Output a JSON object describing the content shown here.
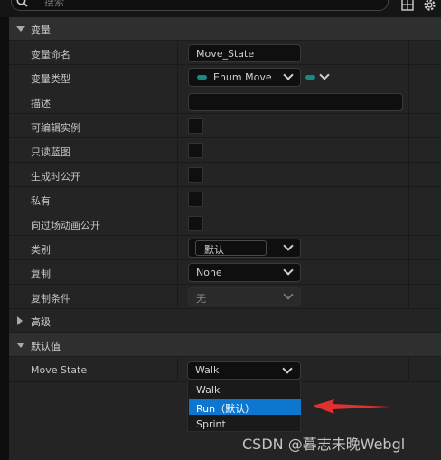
{
  "search": {
    "placeholder": "搜索"
  },
  "sections": {
    "variable": "变量",
    "advanced": "高级",
    "default_value": "默认值"
  },
  "rows": {
    "var_name": {
      "label": "变量命名",
      "value": "Move_State"
    },
    "var_type": {
      "label": "变量类型",
      "value": "Enum Move"
    },
    "description": {
      "label": "描述",
      "value": ""
    },
    "editable": {
      "label": "可编辑实例"
    },
    "readonly": {
      "label": "只读蓝图"
    },
    "expose_spawn": {
      "label": "生成时公开"
    },
    "private": {
      "label": "私有"
    },
    "expose_cinematics": {
      "label": "向过场动画公开"
    },
    "category": {
      "label": "类别",
      "value": "默认"
    },
    "replication": {
      "label": "复制",
      "value": "None"
    },
    "replication_condition": {
      "label": "复制条件",
      "value": "无"
    },
    "move_state": {
      "label": "Move State",
      "value": "Walk"
    }
  },
  "dropdown_options": [
    "Walk",
    "Run（默认）",
    "Sprint"
  ],
  "selected_option": "Run（默认）",
  "watermark": "CSDN @暮志未晚Webgl",
  "colors": {
    "accent": "#0d76cf",
    "enum_pill": "#1a8a80",
    "arrow": "#e03030"
  },
  "icons": [
    "search-icon",
    "grid-icon",
    "gear-icon",
    "chevron-down-icon",
    "arrow-annotation"
  ]
}
